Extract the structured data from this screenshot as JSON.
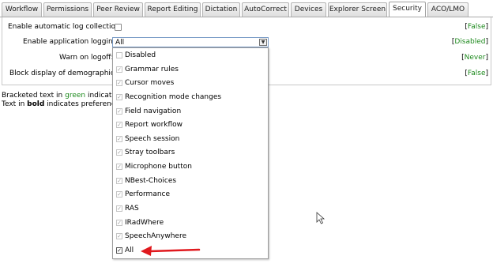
{
  "tabs": [
    "Workflow",
    "Permissions",
    "Peer Review",
    "Report Editing",
    "Dictation",
    "AutoCorrect",
    "Devices",
    "Explorer Screen",
    "Security",
    "ACO/LMO"
  ],
  "active_tab": "Security",
  "settings": {
    "log_collection": {
      "label": "Enable automatic log collection:",
      "value": "False"
    },
    "app_logging": {
      "label": "Enable application logging:",
      "selected": "All",
      "value": "Disabled"
    },
    "warn_logoff": {
      "label": "Warn on logoff:",
      "value": "Never"
    },
    "block_demographics": {
      "label": "Block display of demographics:",
      "value": "False"
    }
  },
  "dropdown_options": [
    {
      "label": "Disabled",
      "checked": false
    },
    {
      "label": "Grammar rules",
      "checked": true
    },
    {
      "label": "Cursor moves",
      "checked": true
    },
    {
      "label": "Recognition mode changes",
      "checked": true
    },
    {
      "label": "Field navigation",
      "checked": true
    },
    {
      "label": "Report workflow",
      "checked": true
    },
    {
      "label": "Speech session",
      "checked": true
    },
    {
      "label": "Stray toolbars",
      "checked": true
    },
    {
      "label": "Microphone button",
      "checked": true
    },
    {
      "label": "NBest-Choices",
      "checked": true
    },
    {
      "label": "Performance",
      "checked": true
    },
    {
      "label": "RAS",
      "checked": true
    },
    {
      "label": "IRadWhere",
      "checked": true
    },
    {
      "label": "SpeechAnywhere",
      "checked": true
    },
    {
      "label": "All",
      "checked": true
    }
  ],
  "footer": {
    "line1_prefix": "Bracketed text in ",
    "line1_green": "green",
    "line1_suffix": " indicates c",
    "line2_prefix": "Text in ",
    "line2_bold": "bold",
    "line2_suffix": " indicates preferences"
  },
  "colors": {
    "green_text": "#1e8a1e",
    "arrow": "#e0191e"
  },
  "icons": {
    "dropdown_button": "chevron-down-icon",
    "annotation_arrow": "red-arrow-icon",
    "mouse_cursor": "cursor-icon"
  }
}
